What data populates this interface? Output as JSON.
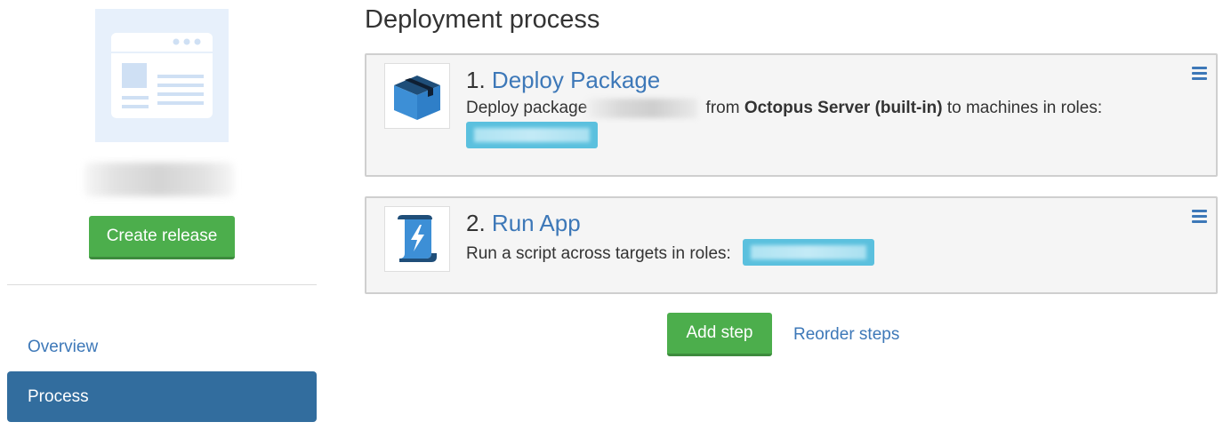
{
  "sidebar": {
    "create_release_label": "Create release",
    "nav": [
      {
        "label": "Overview",
        "active": false
      },
      {
        "label": "Process",
        "active": true
      }
    ]
  },
  "main": {
    "title": "Deployment process",
    "steps": [
      {
        "number": "1.",
        "name": "Deploy Package",
        "icon": "package-box-icon",
        "desc_prefix": "Deploy package",
        "desc_middle": " from ",
        "server": "Octopus Server (built-in)",
        "desc_suffix": " to machines in roles:"
      },
      {
        "number": "2.",
        "name": "Run App",
        "icon": "script-lightning-icon",
        "desc": "Run a script across targets in roles:"
      }
    ],
    "add_step_label": "Add step",
    "reorder_label": "Reorder steps"
  },
  "colors": {
    "primary": "#3d78b8",
    "success": "#4cae4c",
    "active_nav": "#326d9e",
    "role_tag": "#5bc0de"
  }
}
